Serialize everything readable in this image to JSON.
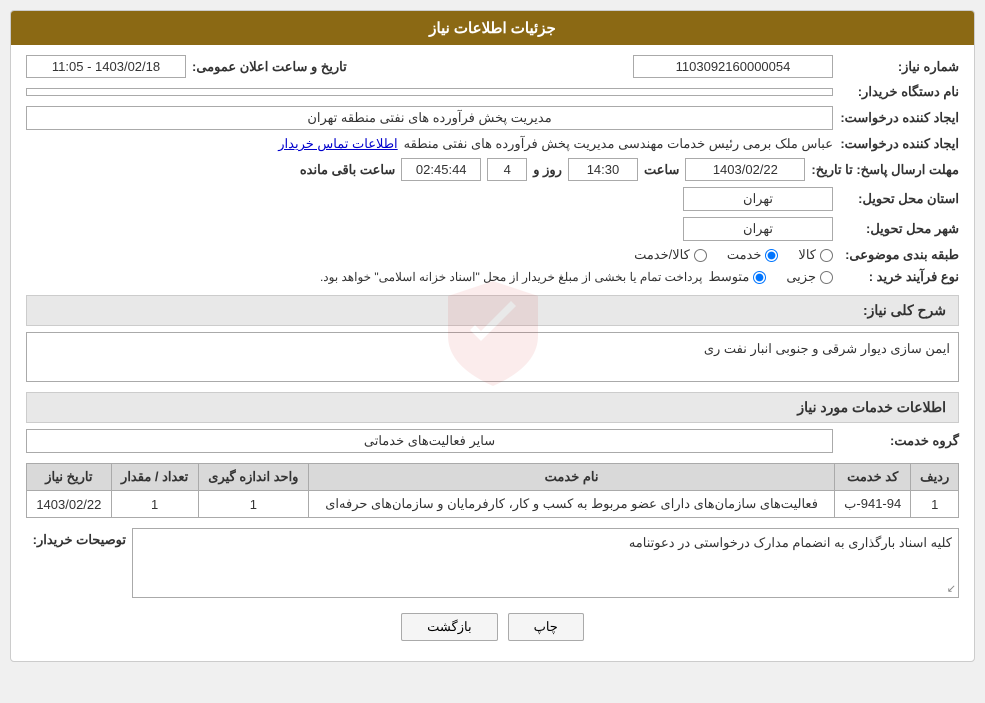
{
  "page": {
    "title": "جزئیات اطلاعات نیاز",
    "fields": {
      "shomareNiaz_label": "شماره نیاز:",
      "shomareNiaz_value": "1103092160000054",
      "namDastgah_label": "نام دستگاه خریدار:",
      "namDastgah_value": "",
      "ijadKonande_label": "ایجاد کننده درخواست:",
      "ijadKonande_value": "مدیریت پخش فرآورده های نفتی منطقه تهران",
      "mohlatErsalPasokh_label": "مهلت ارسال پاسخ: تا تاریخ:",
      "mohlatDate_value": "1403/02/22",
      "mohlatSaat_label": "ساعت",
      "mohlatSaat_value": "14:30",
      "mohlatRooz_label": "روز و",
      "mohlatRooz_value": "4",
      "saatBaqi_label": "ساعت باقی مانده",
      "saatBaqi_value": "02:45:44",
      "tarikhElanLabel": "تاریخ و ساعت اعلان عمومی:",
      "tarikhElan_value": "1403/02/18 - 11:05",
      "estanTahvil_label": "استان محل تحویل:",
      "estanTahvil_value": "تهران",
      "shahrTahvil_label": "شهر محل تحویل:",
      "shahrTahvil_value": "تهران",
      "tabaghebandi_label": "طبقه بندی موضوعی:",
      "tabaghebandi_kala": "کالا",
      "tabaghebandi_khadamat": "خدمت",
      "tabaghebandi_kala_khadamat": "کالا/خدمت",
      "noefarayand_label": "نوع فرآیند خرید :",
      "noefarayand_jozi": "جزیی",
      "noefarayand_motevaset": "متوسط",
      "noefarayand_note": "پرداخت تمام یا بخشی از مبلغ خریدار از محل \"اسناد خزانه اسلامی\" خواهد بود.",
      "ijadKonandeDetailLabel": "ایجاد کننده درخواست:",
      "ijadKonandeDetail_value": "عباس ملک برمی رئیس خدمات مهندسی مدیریت پخش فرآورده های نفتی منطقه",
      "ijadKonandeLink": "اطلاعات تماس خریدار"
    },
    "sharhKolliNiaz": {
      "label": "شرح کلی نیاز:",
      "value": "ایمن سازی دیوار شرقی و جنوبی انبار نفت ری"
    },
    "section2": {
      "title": "اطلاعات خدمات مورد نیاز",
      "groheKhadamat_label": "گروه خدمت:",
      "groheKhadamat_value": "سایر فعالیت‌های خدماتی"
    },
    "table": {
      "headers": [
        "ردیف",
        "کد خدمت",
        "نام خدمت",
        "واحد اندازه گیری",
        "تعداد / مقدار",
        "تاریخ نیاز"
      ],
      "rows": [
        {
          "radif": "1",
          "kodKhadamat": "941-94-ب",
          "namKhadamat": "فعالیت‌های سازمان‌های دارای عضو مربوط به کسب و کار، کارفرمایان و سازمان‌های حرفه‌ای",
          "vahed": "1",
          "tedad": "1",
          "tarikh": "1403/02/22"
        }
      ]
    },
    "toseihKhridar": {
      "label": "توصیحات خریدار:",
      "value": "کلیه اسناد بارگذاری به انضمام مدارک درخواستی در دعوتنامه"
    },
    "buttons": {
      "chap": "چاپ",
      "bazgasht": "بازگشت"
    }
  }
}
